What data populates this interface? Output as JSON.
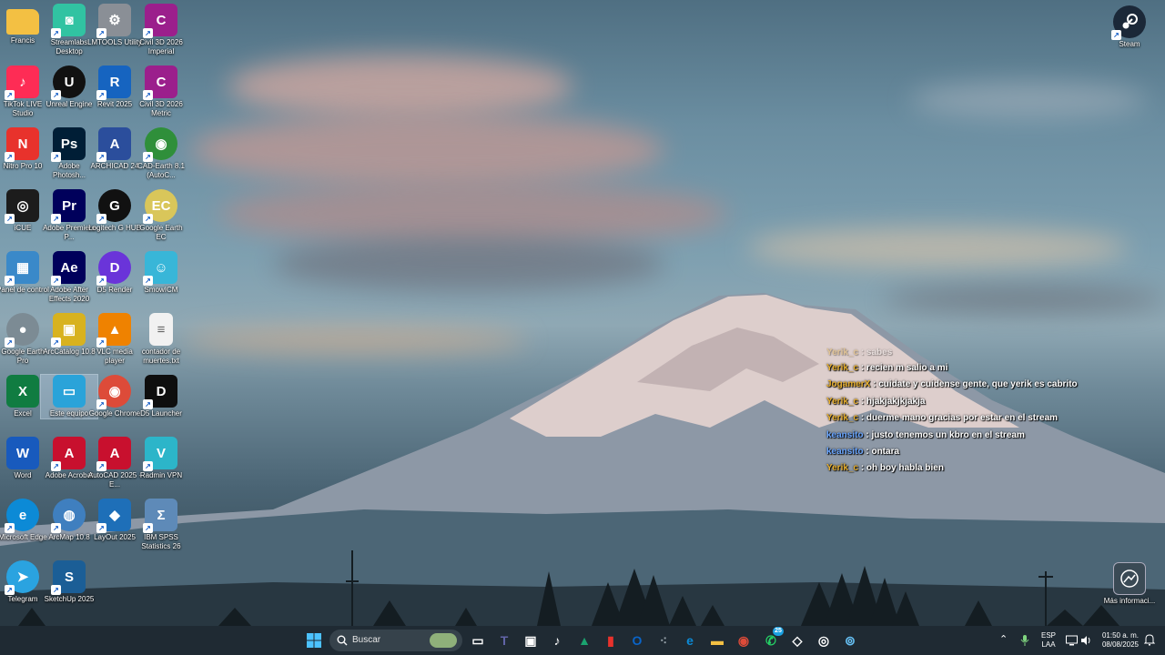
{
  "desktop": {
    "icons": [
      {
        "label": "Francis",
        "icon": "folder-icon",
        "color": "#f3c043"
      },
      {
        "label": "Streamlabs Desktop",
        "icon": "streamlabs-icon",
        "color": "#31c3a2"
      },
      {
        "label": "LMTOOLS Utility",
        "icon": "lmtools-icon",
        "color": "#8a8f96"
      },
      {
        "label": "Civil 3D 2026 Imperial",
        "icon": "civil3d-icon",
        "color": "#9b1f8c"
      },
      {
        "label": "TikTok LIVE Studio",
        "icon": "tiktok-live-icon",
        "color": "#fe2c55"
      },
      {
        "label": "Unreal Engine",
        "icon": "unreal-icon",
        "color": "#111111"
      },
      {
        "label": "Revit 2025",
        "icon": "revit-icon",
        "color": "#1664c0"
      },
      {
        "label": "Civil 3D 2026 Metric",
        "icon": "civil3d-metric-icon",
        "color": "#9b1f8c"
      },
      {
        "label": "Nitro Pro 10",
        "icon": "nitro-icon",
        "color": "#e8322c"
      },
      {
        "label": "Adobe Photosh...",
        "icon": "photoshop-icon",
        "color": "#001e36"
      },
      {
        "label": "ARCHICAD 24",
        "icon": "archicad-icon",
        "color": "#2b4e9c"
      },
      {
        "label": "CAD-Earth 8.1 (AutoC...",
        "icon": "cad-earth-icon",
        "color": "#2f8f3a"
      },
      {
        "label": "iCUE",
        "icon": "icue-icon",
        "color": "#1c1c1c"
      },
      {
        "label": "Adobe Premiere P...",
        "icon": "premiere-icon",
        "color": "#00005b"
      },
      {
        "label": "Logitech G HUB",
        "icon": "logitech-ghub-icon",
        "color": "#111111"
      },
      {
        "label": "Google Earth EC",
        "icon": "google-earth-ec-icon",
        "color": "#d9c65a"
      },
      {
        "label": "Panel de control",
        "icon": "control-panel-icon",
        "color": "#3a89c9"
      },
      {
        "label": "Adobe After Effects 2020",
        "icon": "after-effects-icon",
        "color": "#00005b"
      },
      {
        "label": "D5 Render",
        "icon": "d5-render-icon",
        "color": "#6a34d9"
      },
      {
        "label": "SmowICM",
        "icon": "smowicm-icon",
        "color": "#38b6d8"
      },
      {
        "label": "Google Earth Pro",
        "icon": "google-earth-pro-icon",
        "color": "#7c8b94"
      },
      {
        "label": "ArcCatalog 10.8",
        "icon": "arccatalog-icon",
        "color": "#d8b21f"
      },
      {
        "label": "VLC media player",
        "icon": "vlc-icon",
        "color": "#ef8200"
      },
      {
        "label": "contador de muertes.txt",
        "icon": "text-file-icon",
        "color": "#f1f1f1"
      },
      {
        "label": "Excel",
        "icon": "excel-icon",
        "color": "#107c41"
      },
      {
        "label": "Este equipo",
        "icon": "this-pc-icon",
        "color": "#2aa3d9"
      },
      {
        "label": "Google Chrome",
        "icon": "chrome-icon",
        "color": "#dd4b39"
      },
      {
        "label": "D5 Launcher",
        "icon": "d5-launcher-icon",
        "color": "#0e0e0e"
      },
      {
        "label": "Word",
        "icon": "word-icon",
        "color": "#185abd"
      },
      {
        "label": "Adobe Acrobat",
        "icon": "acrobat-icon",
        "color": "#c8102e"
      },
      {
        "label": "AutoCAD 2025 - E...",
        "icon": "autocad-icon",
        "color": "#c8102e"
      },
      {
        "label": "Radmin VPN",
        "icon": "radmin-vpn-icon",
        "color": "#2cb5c9"
      },
      {
        "label": "Microsoft Edge",
        "icon": "edge-icon",
        "color": "#0c8ad6"
      },
      {
        "label": "ArcMap 10.8",
        "icon": "arcmap-icon",
        "color": "#3f7fbf"
      },
      {
        "label": "LayOut 2025",
        "icon": "layout-icon",
        "color": "#1e6fb8"
      },
      {
        "label": "IBM SPSS Statistics 26",
        "icon": "spss-icon",
        "color": "#5e8ab8"
      },
      {
        "label": "Telegram",
        "icon": "telegram-icon",
        "color": "#2aa3e0"
      },
      {
        "label": "SketchUp 2025",
        "icon": "sketchup-icon",
        "color": "#1b5e96"
      }
    ],
    "right_icons": [
      {
        "label": "Steam",
        "icon": "steam-icon",
        "color": "#1b2838"
      },
      {
        "label": "Más informaci...",
        "icon": "more-info-icon",
        "color": "#3a4a55"
      }
    ]
  },
  "chat": {
    "lines": [
      {
        "user": "Yerik_c",
        "user_color": "#e8b030",
        "text": ": sabes",
        "faded": true
      },
      {
        "user": "Yerik_c",
        "user_color": "#e8b030",
        "text": ": recien m salio a mi"
      },
      {
        "user": "JogamerX",
        "user_color": "#e8b030",
        "text": ": cuidate y cuidense gente, que yerik es cabrito"
      },
      {
        "user": "Yerik_c",
        "user_color": "#e8b030",
        "text": ": hjakjakjkjakja"
      },
      {
        "user": "Yerik_c",
        "user_color": "#e8b030",
        "text": ": duerme mano gracias por estar en el stream"
      },
      {
        "user": "keansito",
        "user_color": "#6aa6ff",
        "text": ": justo tenemos un kbro en el stream"
      },
      {
        "user": "keansito",
        "user_color": "#6aa6ff",
        "text": ": ontara"
      },
      {
        "user": "Yerik_c",
        "user_color": "#e8b030",
        "text": ": oh boy habla bien"
      }
    ]
  },
  "taskbar": {
    "search_label": "Buscar",
    "apps": [
      {
        "name": "task-view-icon",
        "color": "#ffffff"
      },
      {
        "name": "teams-icon",
        "color": "#6264a7"
      },
      {
        "name": "store-icon",
        "color": "#ffffff"
      },
      {
        "name": "tiktok-icon",
        "color": "#ffffff"
      },
      {
        "name": "app-green-icon",
        "color": "#1aa36f"
      },
      {
        "name": "nitro-taskbar-icon",
        "color": "#e8322c"
      },
      {
        "name": "outlook-icon",
        "color": "#0a64c8"
      },
      {
        "name": "app-dots-icon",
        "color": "#9aa5ad"
      },
      {
        "name": "edge-taskbar-icon",
        "color": "#0c8ad6"
      },
      {
        "name": "file-explorer-icon",
        "color": "#f3c043"
      },
      {
        "name": "chrome-taskbar-icon",
        "color": "#dd4b39"
      },
      {
        "name": "whatsapp-icon",
        "color": "#25d366",
        "badge": "25"
      },
      {
        "name": "unity-icon",
        "color": "#ffffff"
      },
      {
        "name": "obs-icon",
        "color": "#ffffff"
      },
      {
        "name": "steam-taskbar-icon",
        "color": "#66c0f4"
      }
    ],
    "tray": {
      "language": "ESP",
      "layout": "LAA",
      "time": "01:50 a. m.",
      "date": "08/08/2025"
    }
  }
}
